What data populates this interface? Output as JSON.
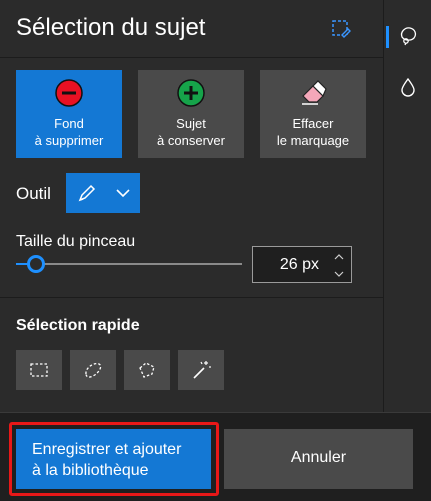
{
  "header": {
    "title": "Sélection du sujet",
    "icon": "mask-edit-icon"
  },
  "modes": [
    {
      "label": "Fond\nà supprimer",
      "icon": "minus-circle-icon",
      "active": true
    },
    {
      "label": "Sujet\nà conserver",
      "icon": "plus-circle-icon",
      "active": false
    },
    {
      "label": "Effacer\nle marquage",
      "icon": "eraser-icon",
      "active": false
    }
  ],
  "tool": {
    "label": "Outil",
    "selected_icon": "pen-icon"
  },
  "brush": {
    "label": "Taille du pinceau",
    "value": "26 px",
    "slider_fraction": 0.09
  },
  "quick_selection": {
    "title": "Sélection rapide",
    "tools": [
      "rectangle-select-icon",
      "lasso-select-icon",
      "polygon-lasso-icon",
      "magic-wand-icon"
    ]
  },
  "footer": {
    "save_label": "Enregistrer et ajouter\nà la bibliothèque",
    "cancel_label": "Annuler"
  },
  "rail": {
    "items": [
      "subject-selection-icon",
      "droplet-icon"
    ]
  },
  "colors": {
    "accent": "#1478d4",
    "highlight_outline": "#e81818",
    "remove_red": "#e81123",
    "keep_green": "#16a34a"
  }
}
